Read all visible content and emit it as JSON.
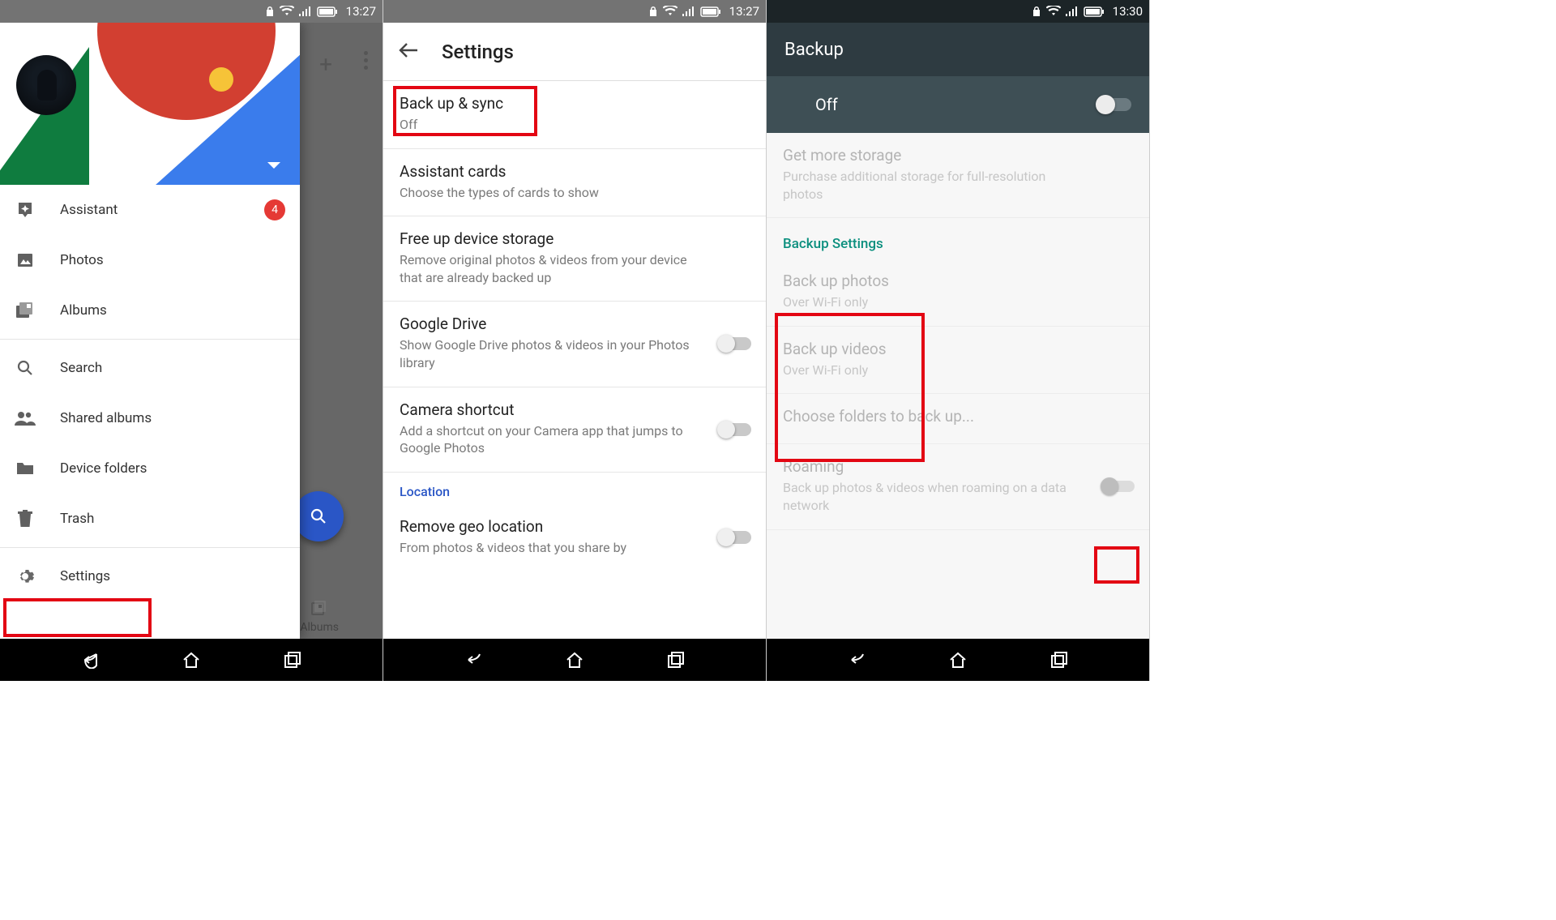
{
  "status": {
    "time1": "13:27",
    "time2": "13:27",
    "time3": "13:30"
  },
  "phone1": {
    "drawer": {
      "items": [
        {
          "icon": "assistant",
          "label": "Assistant",
          "badge": "4"
        },
        {
          "icon": "photos",
          "label": "Photos"
        },
        {
          "icon": "albums",
          "label": "Albums"
        },
        {
          "divider": true
        },
        {
          "icon": "search",
          "label": "Search"
        },
        {
          "icon": "shared",
          "label": "Shared albums"
        },
        {
          "icon": "folders",
          "label": "Device folders"
        },
        {
          "icon": "trash",
          "label": "Trash"
        },
        {
          "divider": true
        },
        {
          "icon": "settings",
          "label": "Settings"
        }
      ]
    },
    "bg_tab": "Albums"
  },
  "phone2": {
    "title": "Settings",
    "items": [
      {
        "title": "Back up & sync",
        "sub": "Off"
      },
      {
        "title": "Assistant cards",
        "sub": "Choose the types of cards to show"
      },
      {
        "title": "Free up device storage",
        "sub": "Remove original photos & videos from your device that are already backed up"
      },
      {
        "title": "Google Drive",
        "sub": "Show Google Drive photos & videos in your Photos library",
        "switch": true
      },
      {
        "title": "Camera shortcut",
        "sub": "Add a shortcut on your Camera app that jumps to Google Photos",
        "switch": true
      }
    ],
    "section": "Location",
    "geo": {
      "title": "Remove geo location",
      "sub": "From photos & videos that you share by"
    }
  },
  "phone3": {
    "title": "Backup",
    "toggle_label": "Off",
    "storage": {
      "title": "Get more storage",
      "sub": "Purchase additional storage for full-resolution photos"
    },
    "section": "Backup Settings",
    "photos": {
      "title": "Back up photos",
      "sub": "Over Wi-Fi only"
    },
    "videos": {
      "title": "Back up videos",
      "sub": "Over Wi-Fi only"
    },
    "choose": "Choose folders to back up...",
    "roaming": {
      "title": "Roaming",
      "sub": "Back up photos & videos when roaming on a data network"
    }
  }
}
